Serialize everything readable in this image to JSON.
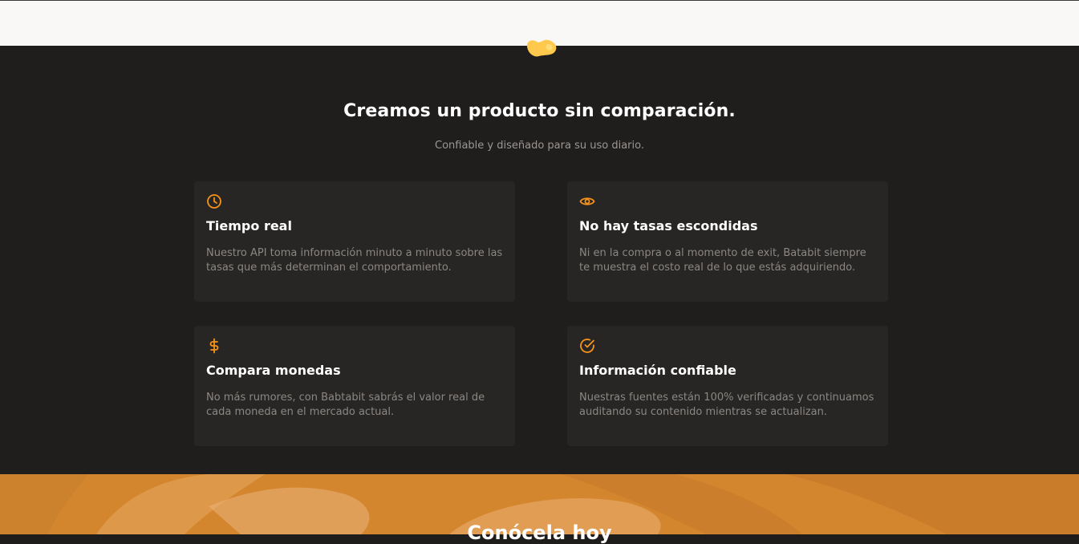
{
  "header": {
    "logo_icon": "batabit-blob-logo",
    "accent": "#ffc94d"
  },
  "features": {
    "title": "Creamos un producto sin comparación.",
    "subtitle": "Confiable y diseñado para su uso diario.",
    "accent_color": "#f7931a",
    "cards": [
      {
        "icon": "clock-icon",
        "title": "Tiempo real",
        "text": "Nuestro API toma información minuto a minuto sobre las tasas que más determinan el comportamiento."
      },
      {
        "icon": "eye-icon",
        "title": "No hay tasas escondidas",
        "text": "Ni en la compra o al momento de exit, Batabit siempre te muestra el costo real de lo que estás adquiriendo."
      },
      {
        "icon": "dollar-icon",
        "title": "Compara monedas",
        "text": "No más rumores, con Babtabit sabrás el valor real de cada moneda en el mercado actual."
      },
      {
        "icon": "check-circle-icon",
        "title": "Información confiable",
        "text": "Nuestras fuentes están 100% verificadas y continuamos auditando su contenido mientras se actualizan."
      }
    ]
  },
  "hero": {
    "title": "Conócela hoy"
  }
}
